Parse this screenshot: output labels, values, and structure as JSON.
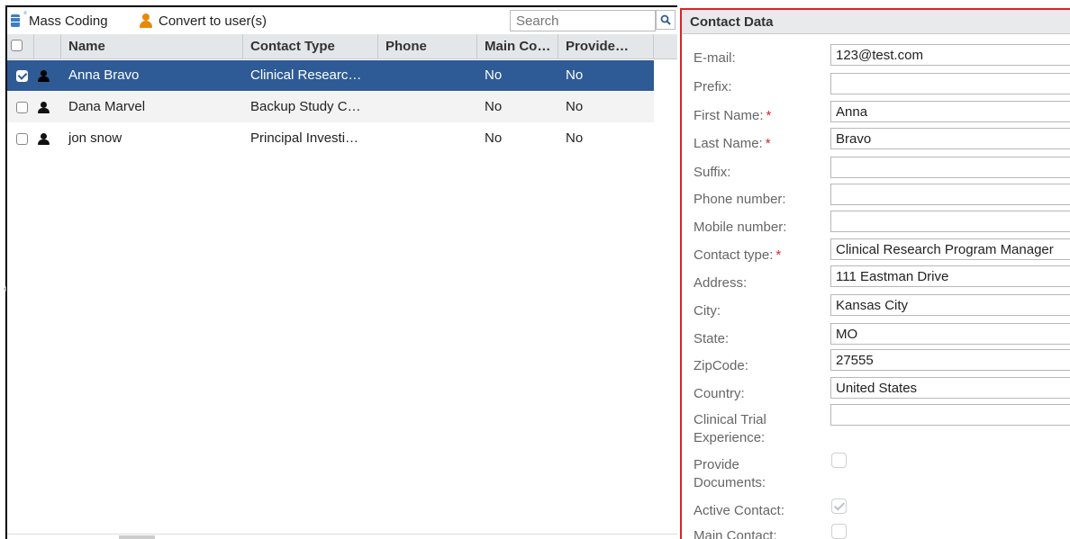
{
  "toolbar": {
    "mass_coding_label": "Mass Coding",
    "convert_label": "Convert to user(s)",
    "search_placeholder": "Search"
  },
  "grid": {
    "columns": {
      "name": "Name",
      "contact_type": "Contact Type",
      "phone": "Phone",
      "main_contact": "Main Co…",
      "provide_docs": "Provide…"
    },
    "rows": [
      {
        "name": "Anna Bravo",
        "contact_type": "Clinical Researc…",
        "phone": "",
        "main_contact": "No",
        "provide_docs": "No",
        "selected": true
      },
      {
        "name": "Dana Marvel",
        "contact_type": "Backup Study C…",
        "phone": "",
        "main_contact": "No",
        "provide_docs": "No",
        "selected": false
      },
      {
        "name": "jon snow",
        "contact_type": "Principal Investi…",
        "phone": "",
        "main_contact": "No",
        "provide_docs": "No",
        "selected": false
      }
    ]
  },
  "contact_panel": {
    "title": "Contact Data",
    "fields": {
      "email": {
        "label": "E-mail:",
        "value": "123@test.com"
      },
      "prefix": {
        "label": "Prefix:",
        "value": ""
      },
      "first_name": {
        "label": "First Name:",
        "value": "Anna",
        "required_mark": "*"
      },
      "last_name": {
        "label": "Last Name:",
        "value": "Bravo",
        "required_mark": "*"
      },
      "suffix": {
        "label": "Suffix:",
        "value": ""
      },
      "phone": {
        "label": "Phone number:",
        "value": ""
      },
      "mobile": {
        "label": "Mobile number:",
        "value": ""
      },
      "contact_type": {
        "label": "Contact type:",
        "value": "Clinical Research Program Manager",
        "required_mark": "*"
      },
      "address": {
        "label": "Address:",
        "value": "111 Eastman Drive"
      },
      "city": {
        "label": "City:",
        "value": "Kansas City"
      },
      "state": {
        "label": "State:",
        "value": "MO"
      },
      "zipcode": {
        "label": "ZipCode:",
        "value": "27555"
      },
      "country": {
        "label": "Country:",
        "value": "United States"
      },
      "clinical_trial_line1": "Clinical Trial",
      "clinical_trial_line2": "Experience:",
      "clinical_trial_value": "",
      "provide_docs_line1": "Provide",
      "provide_docs_line2": "Documents:",
      "provide_docs_checked": false,
      "active_contact": {
        "label": "Active Contact:",
        "checked": true
      },
      "main_contact": {
        "label": "Main Contact:",
        "checked": false
      }
    }
  },
  "colors": {
    "selected_row": "#2e5b96",
    "highlight_border": "#d9232d",
    "icon_blue": "#3d7fc4",
    "icon_orange": "#e8890b"
  }
}
